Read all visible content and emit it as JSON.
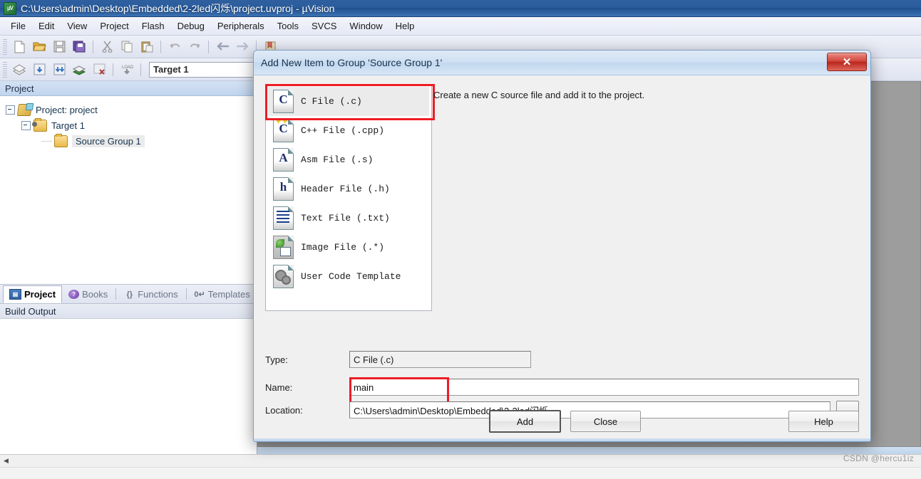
{
  "window": {
    "title": "C:\\Users\\admin\\Desktop\\Embedded\\2-2led闪烁\\project.uvproj - µVision",
    "app_icon": "uvision-icon"
  },
  "menu": {
    "items": [
      "File",
      "Edit",
      "View",
      "Project",
      "Flash",
      "Debug",
      "Peripherals",
      "Tools",
      "SVCS",
      "Window",
      "Help"
    ]
  },
  "toolbar": {
    "row1_icons": [
      "new-file-icon",
      "open-file-icon",
      "save-icon",
      "save-all-icon",
      "cut-icon",
      "copy-icon",
      "paste-icon",
      "undo-icon",
      "redo-icon",
      "navigate-back-icon",
      "navigate-forward-icon"
    ],
    "row2_icons": [
      "build-icon",
      "build-target-icon",
      "rebuild-all-icon",
      "batch-build-icon",
      "stop-build-icon",
      "download-icon"
    ],
    "target_value": "Target 1"
  },
  "project_pane": {
    "header": "Project",
    "tree": [
      {
        "label": "Project: project",
        "icon": "project-icon",
        "level": 1,
        "expanded": true,
        "selected": false
      },
      {
        "label": "Target 1",
        "icon": "target-folder-icon",
        "level": 2,
        "expanded": true,
        "selected": false
      },
      {
        "label": "Source Group 1",
        "icon": "folder-icon",
        "level": 3,
        "expanded": false,
        "selected": true
      }
    ],
    "tabs": [
      {
        "label": "Project",
        "icon": "project-tab-icon",
        "active": true
      },
      {
        "label": "Books",
        "icon": "books-icon",
        "active": false
      },
      {
        "label": "Functions",
        "icon": "functions-icon",
        "active": false
      },
      {
        "label": "Templates",
        "icon": "templates-icon",
        "active": false
      }
    ],
    "build_output_header": "Build Output"
  },
  "dialog": {
    "title": "Add New Item to Group 'Source Group 1'",
    "close_label": "✕",
    "description": "Create a new C source file and add it to the project.",
    "file_types": [
      {
        "label": "C File (.c)",
        "icon": "c-file-icon",
        "glyph": "C",
        "selected": true
      },
      {
        "label": "C++ File (.cpp)",
        "icon": "cpp-file-icon",
        "glyph": "C",
        "selected": false
      },
      {
        "label": "Asm File (.s)",
        "icon": "asm-file-icon",
        "glyph": "A",
        "selected": false
      },
      {
        "label": "Header File (.h)",
        "icon": "header-file-icon",
        "glyph": "h",
        "selected": false
      },
      {
        "label": "Text File (.txt)",
        "icon": "text-file-icon",
        "glyph": "",
        "selected": false
      },
      {
        "label": "Image File (.*)",
        "icon": "image-file-icon",
        "glyph": "",
        "selected": false
      },
      {
        "label": "User Code Template",
        "icon": "user-code-template-icon",
        "glyph": "",
        "selected": false
      }
    ],
    "fields": {
      "type_label": "Type:",
      "type_value": "C File (.c)",
      "name_label": "Name:",
      "name_value": "main",
      "name_placeholder": "",
      "location_label": "Location:",
      "location_value": "C:\\Users\\admin\\Desktop\\Embedded\\2-2led闪烁",
      "browse_label": "..."
    },
    "buttons": {
      "add": "Add",
      "close": "Close",
      "help": "Help"
    },
    "highlight_color": "#ee1c25"
  },
  "watermark": "CSDN @hercu1iz"
}
